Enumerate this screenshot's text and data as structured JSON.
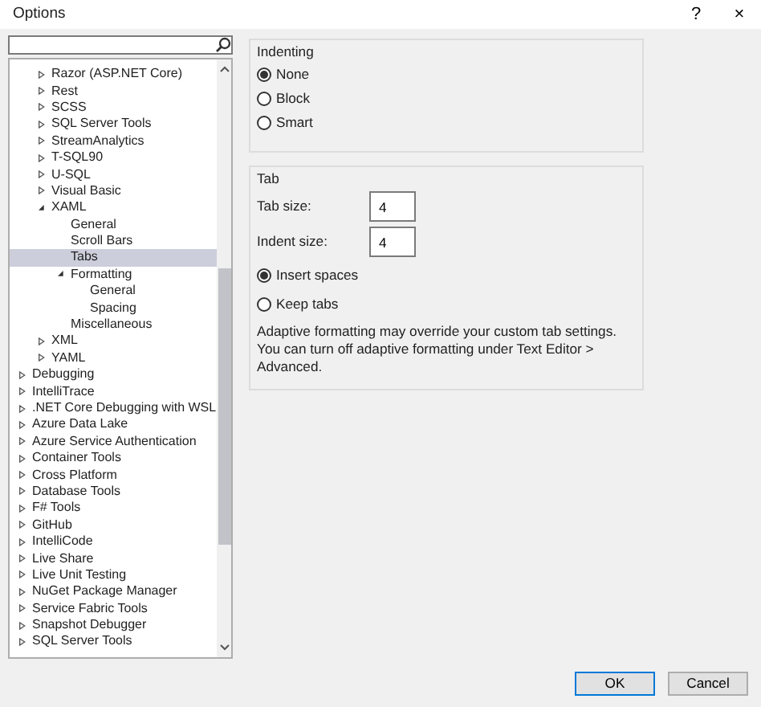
{
  "window": {
    "title": "Options",
    "help": "?",
    "close": "×"
  },
  "tree": {
    "nested_items": [
      {
        "label": "Razor (ASP.NET Core)",
        "expanded": false,
        "selected": false
      },
      {
        "label": "Rest",
        "expanded": false,
        "selected": false
      },
      {
        "label": "SCSS",
        "expanded": false,
        "selected": false
      },
      {
        "label": "SQL Server Tools",
        "expanded": false,
        "selected": false
      },
      {
        "label": "StreamAnalytics",
        "expanded": false,
        "selected": false
      },
      {
        "label": "T-SQL90",
        "expanded": false,
        "selected": false
      },
      {
        "label": "U-SQL",
        "expanded": false,
        "selected": false
      },
      {
        "label": "Visual Basic",
        "expanded": false,
        "selected": false
      },
      {
        "label": "XAML",
        "expanded": true,
        "selected": false,
        "children": [
          {
            "label": "General",
            "selected": false
          },
          {
            "label": "Scroll Bars",
            "selected": false
          },
          {
            "label": "Tabs",
            "selected": true
          },
          {
            "label": "Formatting",
            "expanded": true,
            "selected": false,
            "children": [
              {
                "label": "General",
                "selected": false
              },
              {
                "label": "Spacing",
                "selected": false
              }
            ]
          },
          {
            "label": "Miscellaneous",
            "selected": false
          }
        ]
      },
      {
        "label": "XML",
        "expanded": false,
        "selected": false
      },
      {
        "label": "YAML",
        "expanded": false,
        "selected": false
      }
    ],
    "items": [
      {
        "label": "Debugging",
        "expanded": false,
        "selected": false
      },
      {
        "label": "IntelliTrace",
        "expanded": false,
        "selected": false
      },
      {
        "label": ".NET Core Debugging with WSL",
        "expanded": false,
        "selected": false
      },
      {
        "label": "Azure Data Lake",
        "expanded": false,
        "selected": false
      },
      {
        "label": "Azure Service Authentication",
        "expanded": false,
        "selected": false
      },
      {
        "label": "Container Tools",
        "expanded": false,
        "selected": false
      },
      {
        "label": "Cross Platform",
        "expanded": false,
        "selected": false
      },
      {
        "label": "Database Tools",
        "expanded": false,
        "selected": false
      },
      {
        "label": "F# Tools",
        "expanded": false,
        "selected": false
      },
      {
        "label": "GitHub",
        "expanded": false,
        "selected": false
      },
      {
        "label": "IntelliCode",
        "expanded": false,
        "selected": false
      },
      {
        "label": "Live Share",
        "expanded": false,
        "selected": false
      },
      {
        "label": "Live Unit Testing",
        "expanded": false,
        "selected": false
      },
      {
        "label": "NuGet Package Manager",
        "expanded": false,
        "selected": false
      },
      {
        "label": "Service Fabric Tools",
        "expanded": false,
        "selected": false
      },
      {
        "label": "Snapshot Debugger",
        "expanded": false,
        "selected": false
      },
      {
        "label": "SQL Server Tools",
        "expanded": false,
        "selected": false
      }
    ]
  },
  "indenting": {
    "title": "Indenting",
    "options": [
      {
        "label": "None",
        "selected": true
      },
      {
        "label": "Block",
        "selected": false
      },
      {
        "label": "Smart",
        "selected": false
      }
    ]
  },
  "tab": {
    "title": "Tab",
    "fields": [
      {
        "label": "Tab size:",
        "value": "4"
      },
      {
        "label": "Indent size:",
        "value": "4"
      }
    ],
    "options": [
      {
        "label": "Insert spaces",
        "selected": true
      },
      {
        "label": "Keep tabs",
        "selected": false
      }
    ],
    "note": "Adaptive formatting may override your custom tab settings. You can turn off adaptive formatting under Text Editor > Advanced."
  },
  "buttons": [
    {
      "label": "OK",
      "default": true
    },
    {
      "label": "Cancel",
      "default": false
    }
  ]
}
